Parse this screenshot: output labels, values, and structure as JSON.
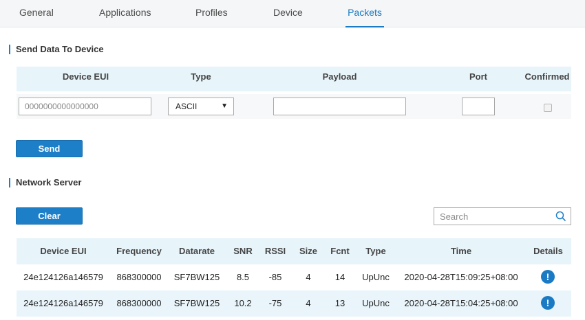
{
  "tabs": [
    {
      "label": "General"
    },
    {
      "label": "Applications"
    },
    {
      "label": "Profiles"
    },
    {
      "label": "Device"
    },
    {
      "label": "Packets",
      "active": true
    }
  ],
  "send_section": {
    "title": "Send Data To Device",
    "columns": [
      "Device EUI",
      "Type",
      "Payload",
      "Port",
      "Confirmed"
    ],
    "device_eui_placeholder": "0000000000000000",
    "device_eui_value": "",
    "type_selected": "ASCII",
    "payload_value": "",
    "port_value": "",
    "confirmed_checked": false,
    "send_label": "Send"
  },
  "network_section": {
    "title": "Network Server",
    "clear_label": "Clear",
    "search_placeholder": "Search",
    "columns": [
      "Device EUI",
      "Frequency",
      "Datarate",
      "SNR",
      "RSSI",
      "Size",
      "Fcnt",
      "Type",
      "Time",
      "Details"
    ],
    "rows": [
      {
        "eui": "24e124126a146579",
        "frequency": "868300000",
        "datarate": "SF7BW125",
        "snr": "8.5",
        "rssi": "-85",
        "size": "4",
        "fcnt": "14",
        "type": "UpUnc",
        "time": "2020-04-28T15:09:25+08:00",
        "details": "!"
      },
      {
        "eui": "24e124126a146579",
        "frequency": "868300000",
        "datarate": "SF7BW125",
        "snr": "10.2",
        "rssi": "-75",
        "size": "4",
        "fcnt": "13",
        "type": "UpUnc",
        "time": "2020-04-28T15:04:25+08:00",
        "details": "!"
      }
    ]
  },
  "colors": {
    "accent": "#1e7fc9",
    "header_bg": "#e7f4fa",
    "tab_bg": "#f4f6f7"
  }
}
